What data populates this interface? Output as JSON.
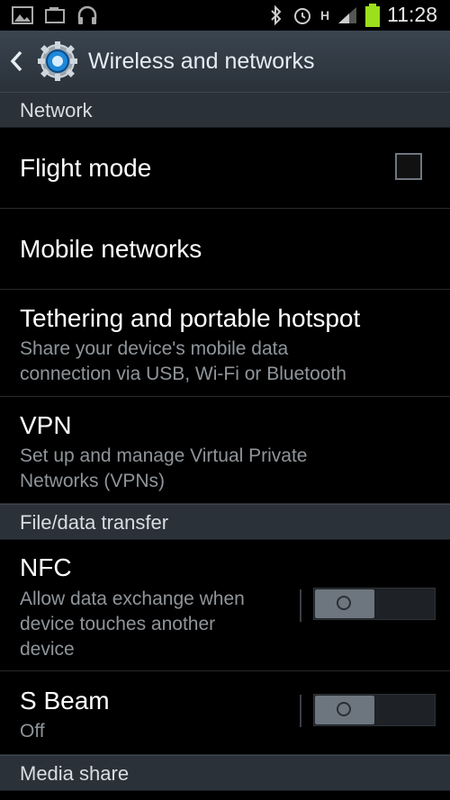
{
  "status": {
    "time": "11:28",
    "network_label": "H"
  },
  "header": {
    "title": "Wireless and networks"
  },
  "sections": {
    "network": "Network",
    "file_transfer": "File/data transfer",
    "media_share": "Media share"
  },
  "items": {
    "flight_mode": {
      "title": "Flight mode",
      "checked": false
    },
    "mobile_networks": {
      "title": "Mobile networks"
    },
    "tethering": {
      "title": "Tethering and portable hotspot",
      "sub1": "Share your device's mobile data",
      "sub2": "connection via USB, Wi-Fi or Bluetooth"
    },
    "vpn": {
      "title": "VPN",
      "sub1": "Set up and manage Virtual Private",
      "sub2": "Networks (VPNs)"
    },
    "nfc": {
      "title": "NFC",
      "sub1": "Allow data exchange when",
      "sub2": "device touches another",
      "sub3": "device",
      "enabled": false
    },
    "s_beam": {
      "title": "S Beam",
      "sub": "Off",
      "enabled": false
    }
  },
  "colors": {
    "accent": "#1e88d8",
    "section_bg": "#2b3138",
    "toggle_knob": "#6d767e"
  }
}
